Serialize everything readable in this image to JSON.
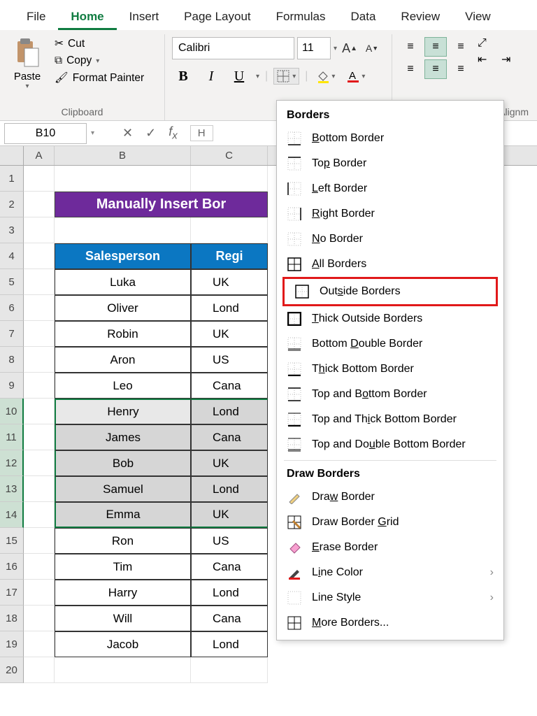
{
  "ribbon": {
    "tabs": [
      "File",
      "Home",
      "Insert",
      "Page Layout",
      "Formulas",
      "Data",
      "Review",
      "View"
    ],
    "active_tab": "Home",
    "clipboard": {
      "paste": "Paste",
      "cut": "Cut",
      "copy": "Copy",
      "painter": "Format Painter",
      "label": "Clipboard"
    },
    "font": {
      "name": "Calibri",
      "size": "11",
      "bold": "B",
      "italic": "I",
      "underline": "U"
    },
    "alignment_label": "Alignm"
  },
  "namebox": "B10",
  "formula_preview": "H",
  "banner_title": "Manually Insert Bor",
  "headers": {
    "sales": "Salesperson",
    "region": "Regi"
  },
  "rows": [
    {
      "name": "Luka",
      "region": "UK"
    },
    {
      "name": "Oliver",
      "region": "Lond"
    },
    {
      "name": "Robin",
      "region": "UK"
    },
    {
      "name": "Aron",
      "region": "US"
    },
    {
      "name": "Leo",
      "region": "Cana"
    },
    {
      "name": "Henry",
      "region": "Lond"
    },
    {
      "name": "James",
      "region": "Cana"
    },
    {
      "name": "Bob",
      "region": "UK"
    },
    {
      "name": "Samuel",
      "region": "Lond"
    },
    {
      "name": "Emma",
      "region": "UK"
    },
    {
      "name": "Ron",
      "region": "US"
    },
    {
      "name": "Tim",
      "region": "Cana"
    },
    {
      "name": "Harry",
      "region": "Lond"
    },
    {
      "name": "Will",
      "region": "Cana"
    },
    {
      "name": "Jacob",
      "region": "Lond"
    }
  ],
  "borders_menu": {
    "title": "Borders",
    "items1": [
      "Bottom Border",
      "Top Border",
      "Left Border",
      "Right Border",
      "No Border",
      "All Borders",
      "Outside Borders",
      "Thick Outside Borders",
      "Bottom Double Border",
      "Thick Bottom Border",
      "Top and Bottom Border",
      "Top and Thick Bottom Border",
      "Top and Double Bottom Border"
    ],
    "title2": "Draw Borders",
    "items2": [
      "Draw Border",
      "Draw Border Grid",
      "Erase Border",
      "Line Color",
      "Line Style",
      "More Borders..."
    ],
    "highlighted": "Outside Borders"
  }
}
